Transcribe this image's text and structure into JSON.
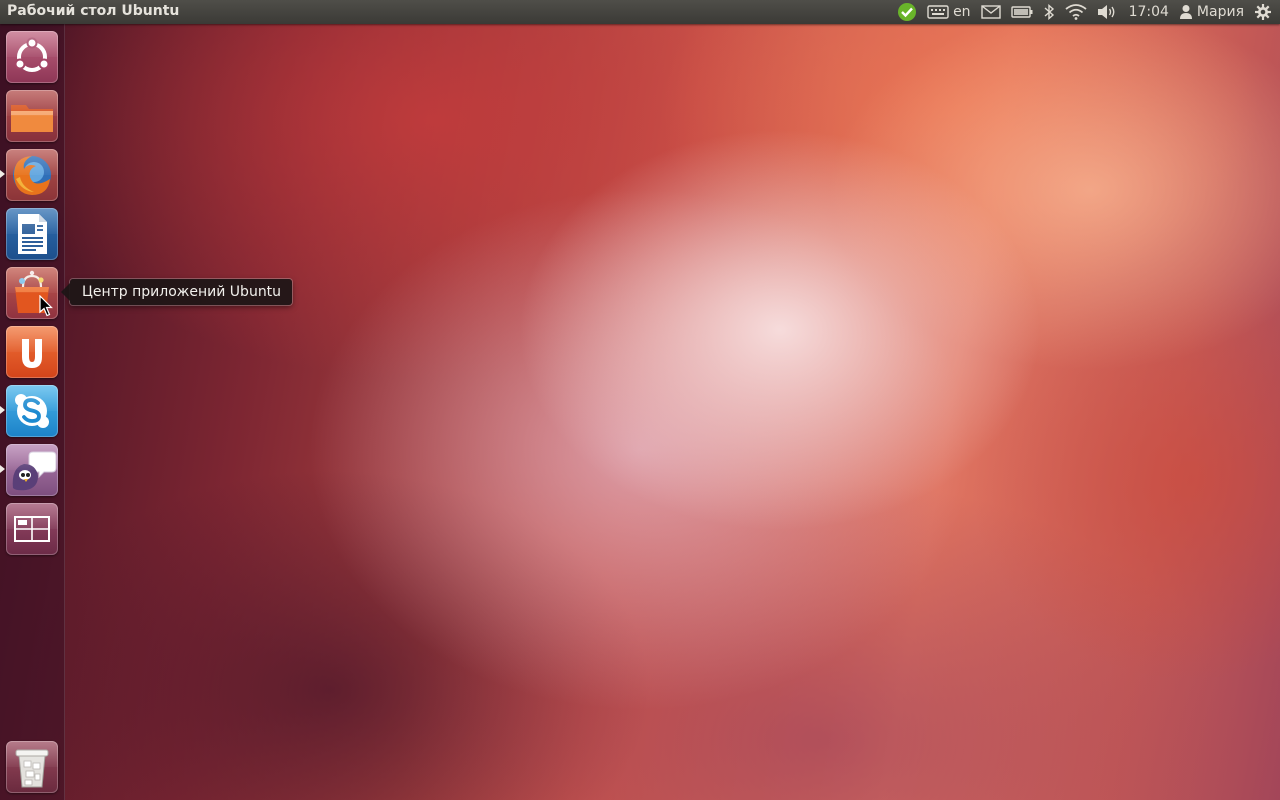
{
  "panel": {
    "title": "Рабочий стол Ubuntu",
    "keyboard_layout": "en",
    "clock": "17:04",
    "user": "Мария"
  },
  "launcher": {
    "items": [
      {
        "name": "dash-home",
        "icon": "ubuntu-logo-icon"
      },
      {
        "name": "home-folder",
        "icon": "folder-icon"
      },
      {
        "name": "firefox",
        "icon": "firefox-icon",
        "running": true
      },
      {
        "name": "libreoffice-writer",
        "icon": "writer-icon"
      },
      {
        "name": "ubuntu-software-center",
        "icon": "software-center-icon"
      },
      {
        "name": "ubuntu-one",
        "icon": "ubuntu-one-icon"
      },
      {
        "name": "skype",
        "icon": "skype-icon",
        "running": true
      },
      {
        "name": "pidgin",
        "icon": "pidgin-icon",
        "running": true
      },
      {
        "name": "workspace-switcher",
        "icon": "workspace-switcher-icon"
      },
      {
        "name": "trash",
        "icon": "trash-icon"
      }
    ],
    "tooltip": "Центр приложений Ubuntu"
  },
  "colors": {
    "panel": "#3b3a36",
    "accent": "#dd4814",
    "indicator_green": "#69b42a"
  }
}
